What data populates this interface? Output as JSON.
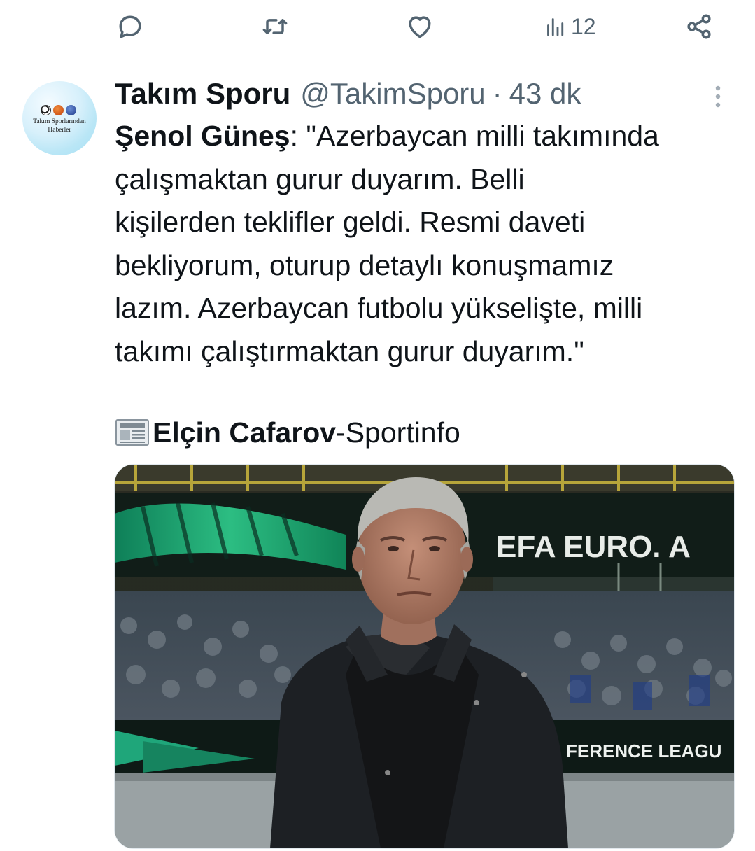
{
  "actions": {
    "reply_icon": "speech-bubble-icon",
    "retweet_icon": "retweet-icon",
    "like_icon": "heart-icon",
    "views_icon": "bar-chart-icon",
    "views_count": "12",
    "share_icon": "share-icon"
  },
  "tweet": {
    "avatar": {
      "text_line1": "Takım Sporlarından",
      "text_line2": "Haberler"
    },
    "display_name": "Takım Sporu",
    "handle": "@TakimSporu",
    "separator": "·",
    "time": "43 dk",
    "text": {
      "bold_name": "Şenol Güneş",
      "line1_rest": ": \"Azerbaycan milli takımında",
      "line2": "çalışmaktan gurur duyarım. Belli",
      "line3": "kişilerden teklifler geldi. Resmi daveti",
      "line4": "bekliyorum, oturup detaylı konuşmamız",
      "line5": "lazım. Azerbaycan futbolu yükselişte, milli",
      "line6": "takımı çalıştırmaktan gurur duyarım.\""
    },
    "credit": {
      "icon": "newspaper-icon",
      "author": "Elçin Cafarov",
      "source": "-Sportinfo"
    },
    "media": {
      "banner_text_1": "EFA EURO. A",
      "banner_text_2": "FERENCE LEAGU"
    }
  },
  "colors": {
    "text_primary": "#0f1419",
    "text_secondary": "#536471",
    "divider": "#e6e9ec",
    "conference_green": "#1fa67a"
  }
}
